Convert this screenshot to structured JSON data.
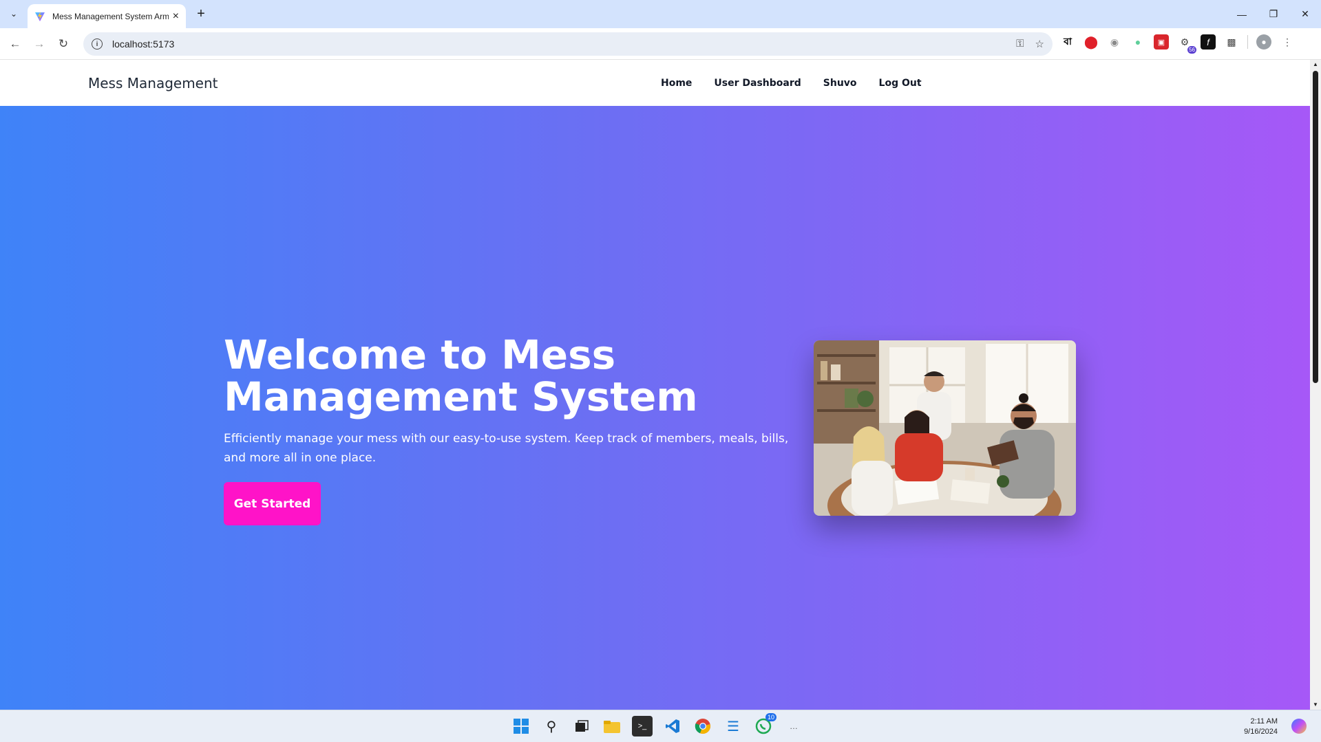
{
  "browser": {
    "tab_title": "Mess Management System Arm",
    "url": "localhost:5173",
    "extension_badge": "56",
    "extension_letter": "বা"
  },
  "site": {
    "brand": "Mess Management",
    "nav": [
      "Home",
      "User Dashboard",
      "Shuvo",
      "Log Out"
    ]
  },
  "hero": {
    "title": "Welcome to Mess Management System",
    "description": "Efficiently manage your mess with our easy-to-use system. Keep track of members, meals, bills, and more all in one place.",
    "cta": "Get Started",
    "image": "people-studying-at-table-photo"
  },
  "taskbar": {
    "whatsapp_badge": "10",
    "time": "2:11 AM",
    "date": "9/16/2024"
  },
  "colors": {
    "gradient_start": "#3f83f8",
    "gradient_end": "#a658f7",
    "cta": "#ff13c8"
  }
}
